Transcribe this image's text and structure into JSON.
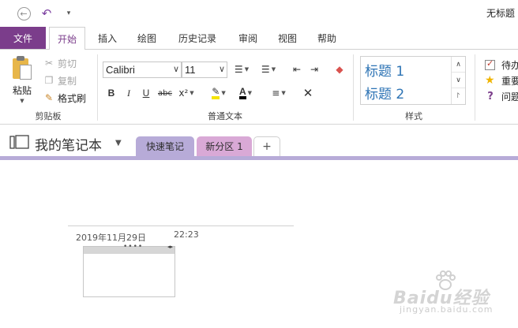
{
  "titlebar": {
    "window_title": "无标题",
    "back_icon": "back-arrow-icon",
    "undo_icon": "undo-icon",
    "customize_icon": "dropdown-caret-icon"
  },
  "ribbon_tabs": [
    {
      "label": "文件"
    },
    {
      "label": "开始"
    },
    {
      "label": "插入"
    },
    {
      "label": "绘图"
    },
    {
      "label": "历史记录"
    },
    {
      "label": "审阅"
    },
    {
      "label": "视图"
    },
    {
      "label": "帮助"
    }
  ],
  "clipboard": {
    "paste_label": "粘贴",
    "cut_label": "剪切",
    "copy_label": "复制",
    "format_painter_label": "格式刷",
    "group_label": "剪贴板"
  },
  "basic_text": {
    "font_name": "Calibri",
    "font_size": "11",
    "bold_label": "B",
    "italic_label": "I",
    "underline_label": "U",
    "strike_label": "abc",
    "superscript_label": "x²",
    "group_label": "普通文本"
  },
  "styles": {
    "heading1": "标题 1",
    "heading2": "标题 2",
    "group_label": "样式"
  },
  "tags": {
    "todo": "待办",
    "important": "重要",
    "question": "问题"
  },
  "notebook": {
    "name": "我的笔记本",
    "sections": [
      {
        "label": "快速笔记",
        "color": "#b7abd8"
      },
      {
        "label": "新分区 1",
        "color": "#d9a9d6"
      }
    ],
    "add_tab_label": "+"
  },
  "page": {
    "date": "2019年11月29日",
    "time": "22:23"
  },
  "watermark": {
    "main": "Baidu经验",
    "sub": "jingyan.baidu.com"
  },
  "colors": {
    "accent": "#7b3d8b",
    "heading": "#2e74b5",
    "quick_notes_tab": "#b7abd8",
    "new_section_tab": "#d9a9d6"
  }
}
